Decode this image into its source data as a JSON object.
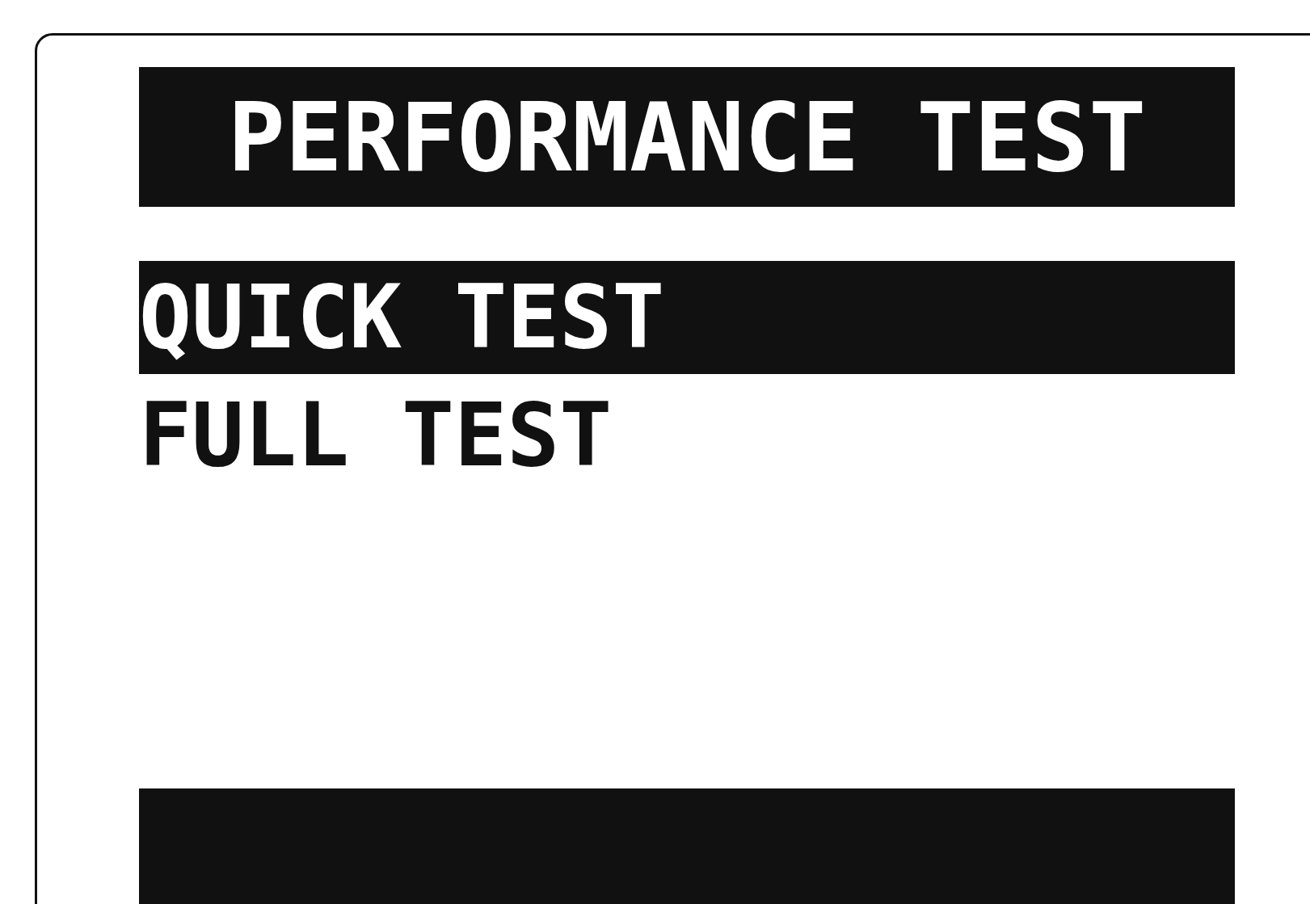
{
  "screen": {
    "title": "PERFORMANCE TEST"
  },
  "menu": [
    {
      "label": "QUICK TEST",
      "selected": true
    },
    {
      "label": "FULL TEST",
      "selected": false
    }
  ]
}
